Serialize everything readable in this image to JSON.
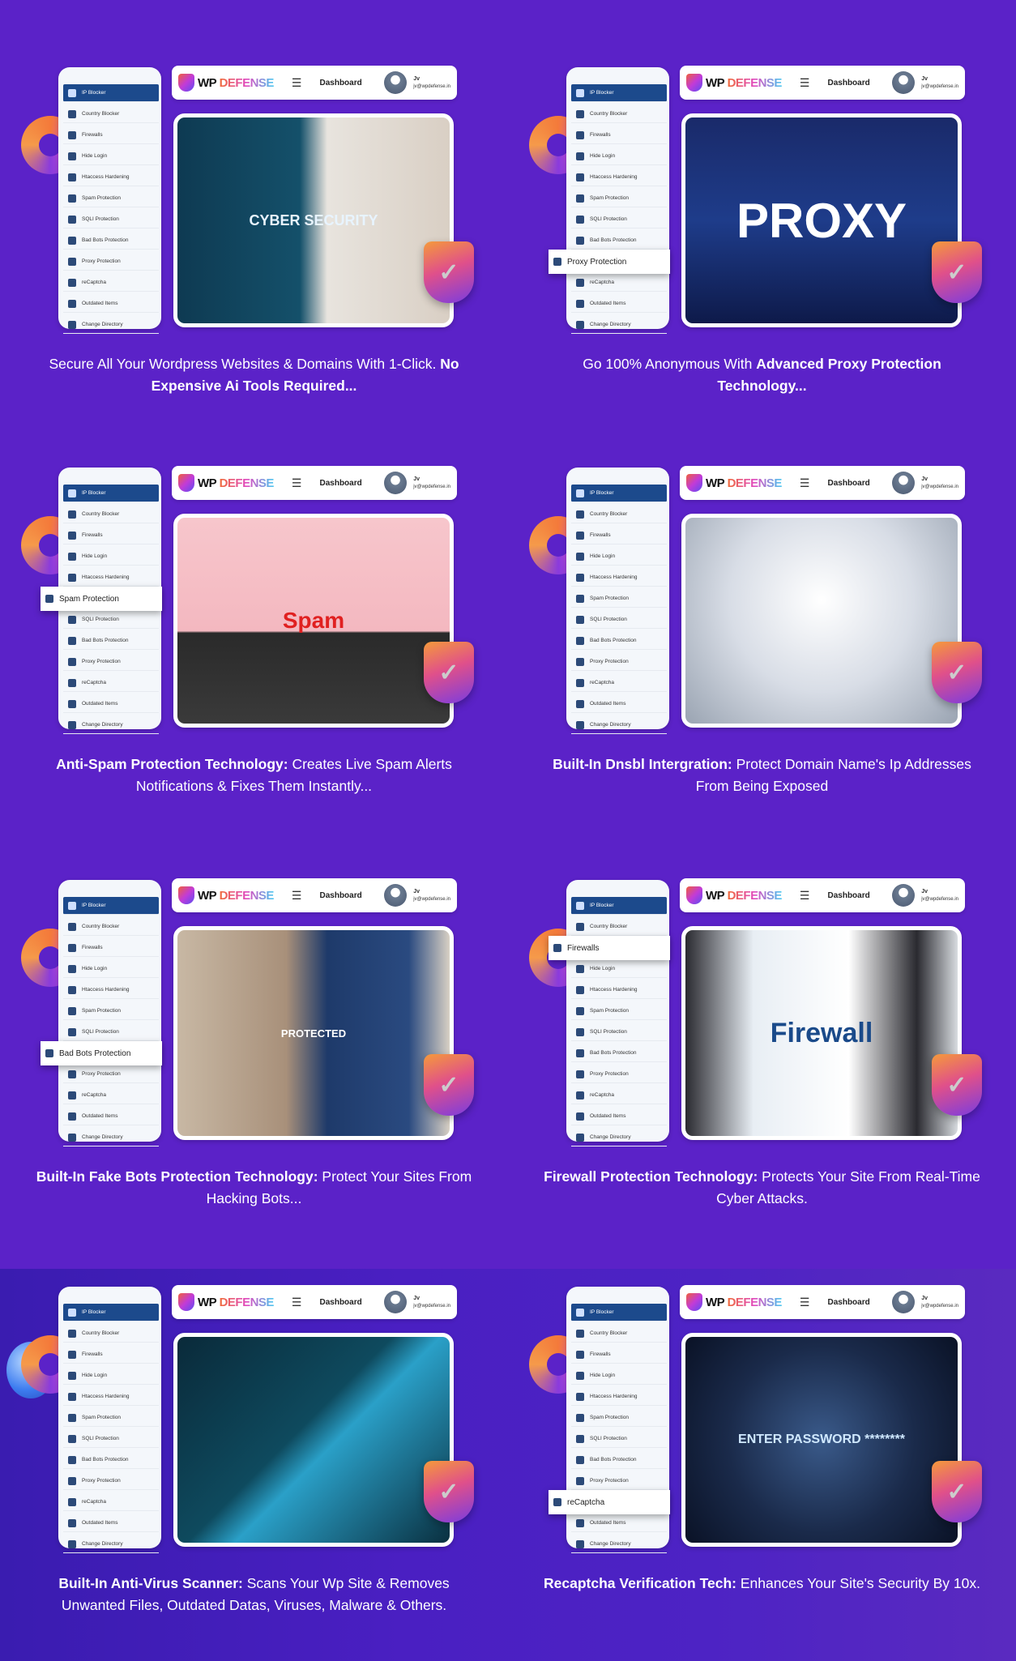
{
  "colors": {
    "background": "#5b22c8",
    "sidebar_active": "#1c4a8c",
    "badge_gradient": [
      "#f59a3a",
      "#e0508a",
      "#7a3ce0"
    ]
  },
  "header": {
    "logo_wp": "WP",
    "logo_defense": "DEFENSE",
    "menu_icon": "hamburger-icon",
    "dashboard_label": "Dashboard",
    "user_name": "Jv",
    "user_email": "jv@wpdefense.in"
  },
  "sidebar_items": [
    {
      "label": "IP Blocker",
      "icon": "ip-blocker-icon"
    },
    {
      "label": "Country Blocker",
      "icon": "country-blocker-icon"
    },
    {
      "label": "Firewalls",
      "icon": "firewall-icon"
    },
    {
      "label": "Hide Login",
      "icon": "hide-login-icon"
    },
    {
      "label": "Htaccess Hardening",
      "icon": "htaccess-icon"
    },
    {
      "label": "Spam Protection",
      "icon": "spam-icon"
    },
    {
      "label": "SQLI Protection",
      "icon": "sqli-icon"
    },
    {
      "label": "Bad Bots Protection",
      "icon": "bad-bots-icon"
    },
    {
      "label": "Proxy Protection",
      "icon": "proxy-icon"
    },
    {
      "label": "reCaptcha",
      "icon": "recaptcha-icon"
    },
    {
      "label": "Outdated Items",
      "icon": "outdated-icon"
    },
    {
      "label": "Change Directory",
      "icon": "change-directory-icon"
    }
  ],
  "cards": [
    {
      "highlight": null,
      "photo_text": "CYBER SECURITY",
      "photo_bg": "linear-gradient(90deg,#0e3a52 0%,#14506a 45%,#e8e4de 55%,#d9cfc4 100%)",
      "photo_color": "#e8f4ff",
      "photo_size": 18,
      "caption": [
        {
          "text": "Secure All Your Wordpress Websites & Domains With 1-Click. ",
          "bold": false
        },
        {
          "text": "No Expensive Ai Tools Required...",
          "bold": true
        }
      ]
    },
    {
      "highlight": 8,
      "photo_text": "PROXY",
      "photo_bg": "linear-gradient(180deg,#1a2a6a,#1e3c8a 50%,#0e1a4a)",
      "photo_color": "#ffffff",
      "photo_size": 60,
      "caption": [
        {
          "text": "Go 100% Anonymous With ",
          "bold": false
        },
        {
          "text": "Advanced Proxy Protection Technology...",
          "bold": true
        }
      ]
    },
    {
      "highlight": 5,
      "photo_text": "Spam",
      "photo_bg": "linear-gradient(180deg,#f7c6cc,#f4b8c0 55%,#2a2a2a 56%,#3a3a3a)",
      "photo_color": "#e02020",
      "photo_size": 28,
      "caption": [
        {
          "text": "Anti-Spam Protection Technology: ",
          "bold": true
        },
        {
          "text": "Creates Live Spam Alerts Notifications & Fixes Them Instantly...",
          "bold": false
        }
      ]
    },
    {
      "highlight": null,
      "photo_text": "",
      "photo_bg": "radial-gradient(circle at 50% 40%,#ffffff,#d8dde6 50%,#9aa4b2)",
      "photo_color": "#ffffff",
      "photo_size": 20,
      "caption": [
        {
          "text": "Built-In Dnsbl Intergration: ",
          "bold": true
        },
        {
          "text": "Protect Domain Name's Ip Addresses From Being Exposed",
          "bold": false
        }
      ]
    },
    {
      "highlight": 7,
      "photo_text": "PROTECTED",
      "photo_bg": "linear-gradient(90deg,#c8b8a4 0%,#a8907a 40%,#1e3a6a 55%,#2a4a80 85%,#d8d0c4 100%)",
      "photo_color": "#ffffff",
      "photo_size": 13,
      "caption": [
        {
          "text": "Built-In Fake Bots Protection Technology: ",
          "bold": true
        },
        {
          "text": "Protect Your Sites From Hacking Bots...",
          "bold": false
        }
      ]
    },
    {
      "highlight": 2,
      "photo_text": "Firewall",
      "photo_bg": "linear-gradient(90deg,#2a2a30 0%,#e8eef4 25%,#ffffff 60%,#2a2a30 85%,#d8dce0 100%)",
      "photo_color": "#1a4a8a",
      "photo_size": 34,
      "caption": [
        {
          "text": "Firewall Protection Technology: ",
          "bold": true
        },
        {
          "text": "Protects Your Site From Real-Time Cyber Attacks.",
          "bold": false
        }
      ]
    },
    {
      "highlight": null,
      "photo_text": "",
      "photo_bg": "linear-gradient(135deg,#0a2a3a,#0e4a5e 45%,#2aa0c8 55%,#0a3040)",
      "photo_color": "#ffffff",
      "photo_size": 20,
      "orb": true,
      "caption": [
        {
          "text": "Built-In Anti-Virus Scanner: ",
          "bold": true
        },
        {
          "text": "Scans Your Wp Site & Removes Unwanted Files, Outdated Datas, Viruses, Malware & Others.",
          "bold": false
        }
      ]
    },
    {
      "highlight": 9,
      "photo_text": "ENTER PASSWORD ********",
      "photo_bg": "radial-gradient(circle at 50% 50%,#3a5a8a,#1a2a4a 55%,#0a1226)",
      "photo_color": "#cfe8ff",
      "photo_size": 16,
      "caption": [
        {
          "text": "Recaptcha Verification Tech: ",
          "bold": true
        },
        {
          "text": "Enhances Your Site's Security By 10x.",
          "bold": false
        }
      ]
    }
  ]
}
